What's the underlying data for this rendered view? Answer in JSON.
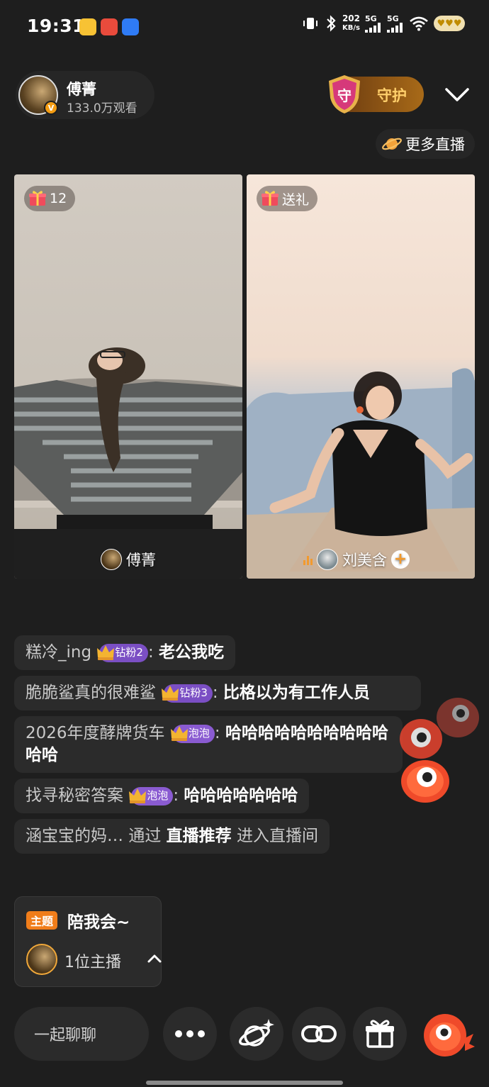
{
  "status_bar": {
    "time": "19:31",
    "net_speed_value": "202",
    "net_speed_unit": "KB/s",
    "sim1": "5G",
    "sim2": "5G"
  },
  "header": {
    "host_name": "傅菁",
    "viewers": "133.0万观看",
    "guard_label": "守护",
    "guard_shield_char": "守",
    "more_live_label": "更多直播"
  },
  "panes": {
    "left": {
      "gift_count": "12",
      "name": "傅菁"
    },
    "right": {
      "gift_label": "送礼",
      "name": "刘美含"
    }
  },
  "chat": [
    {
      "user": "糕冷_ing",
      "badge": "钻粉2",
      "text": "老公我吃"
    },
    {
      "user": "脆脆鲨真的很难鲨",
      "badge": "钻粉3",
      "text": "比格以为有工作人员"
    },
    {
      "user": "2026年度酵牌货车",
      "badge": "泡泡",
      "text": "哈哈哈哈哈哈哈哈哈哈哈哈"
    },
    {
      "user": "找寻秘密答案",
      "badge": "泡泡",
      "text": "哈哈哈哈哈哈哈"
    }
  ],
  "join_notice": {
    "user": "涵宝宝的妈…",
    "via": "通过",
    "source": "直播推荐",
    "action": "进入直播间"
  },
  "topic": {
    "tag": "主题",
    "title": "陪我会~",
    "count": "1位主播"
  },
  "bottom_bar": {
    "chat_placeholder": "一起聊聊"
  },
  "colors": {
    "background": "#1e1e1e",
    "accent_orange": "#f07d1a",
    "badge_purple": "#7b4fc4",
    "guard_gold": "#ffcf6b"
  }
}
